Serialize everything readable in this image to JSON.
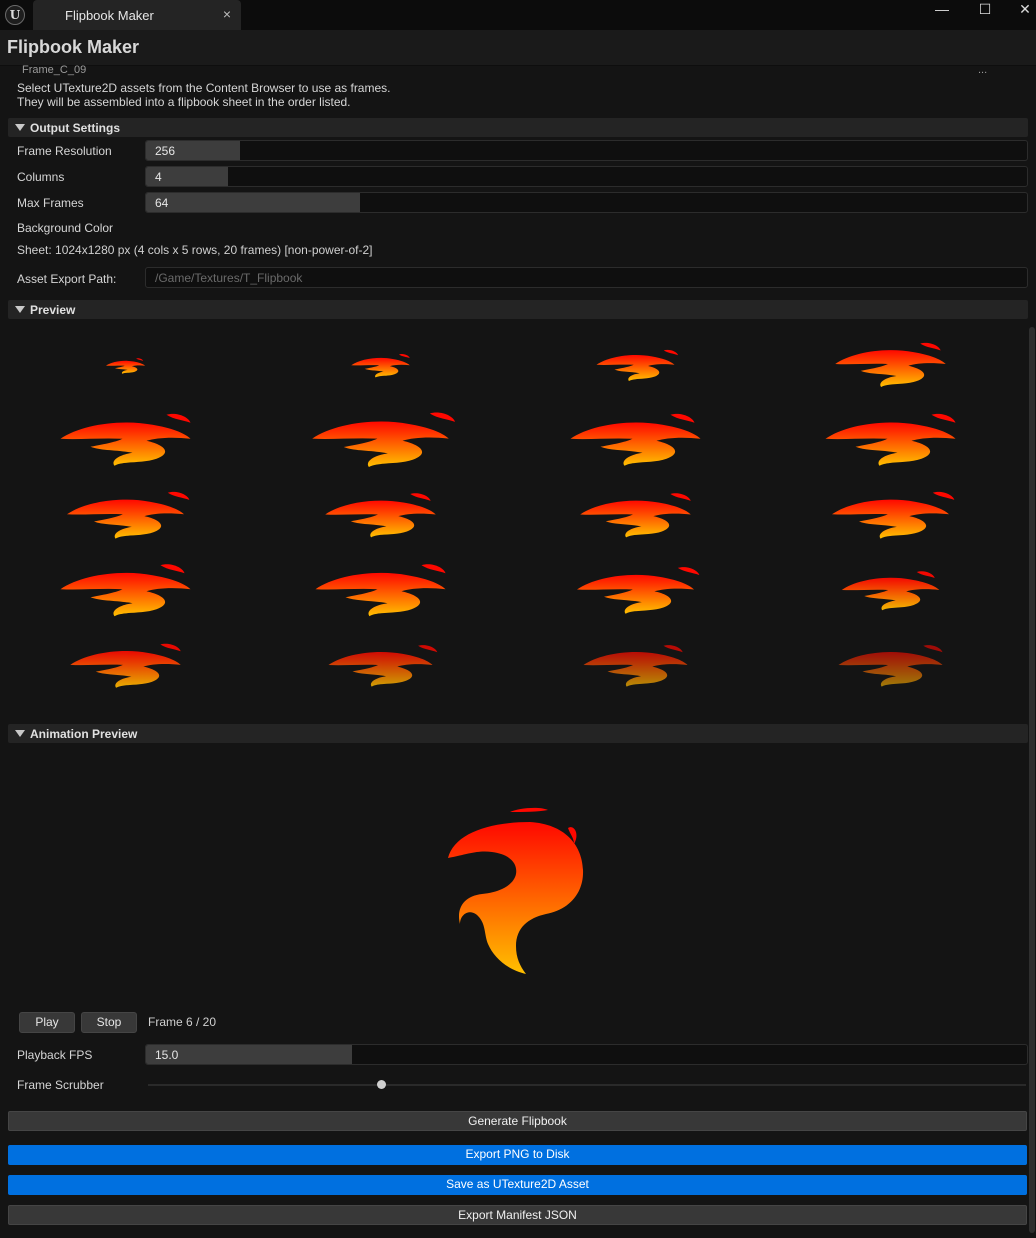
{
  "window": {
    "tab_title": "Flipbook Maker",
    "close_glyph": "×",
    "minimize_glyph": "—",
    "maximize_glyph": "☐",
    "win_close_glyph": "✕",
    "logo_glyph": "U",
    "logo_icon": "unreal-engine-logo"
  },
  "header": {
    "title": "Flipbook Maker"
  },
  "frames_list": {
    "partial_item": "Frame_C_09",
    "partial_suffix": "..."
  },
  "help_text": {
    "line1": "Select UTexture2D assets from the Content Browser to use as frames.",
    "line2": "They will be assembled into a flipbook sheet in the order listed."
  },
  "output_settings": {
    "header": "Output Settings",
    "frame_resolution": {
      "label": "Frame Resolution",
      "value": "256",
      "fill": 0.107
    },
    "columns": {
      "label": "Columns",
      "value": "4",
      "fill": 0.093
    },
    "max_frames": {
      "label": "Max Frames",
      "value": "64",
      "fill": 0.243
    },
    "background_color_label": "Background Color",
    "sheet_info": "Sheet: 1024x1280 px (4 cols x 5 rows, 20 frames) [non-power-of-2]",
    "export_path": {
      "label": "Asset Export Path:",
      "placeholder": "/Game/Textures/T_Flipbook"
    }
  },
  "preview": {
    "header": "Preview",
    "columns": 4,
    "rows": 5,
    "frame_count": 20,
    "colors": {
      "top": "#ff0800",
      "bottom": "#ffc000"
    }
  },
  "animation_preview": {
    "header": "Animation Preview",
    "play_label": "Play",
    "stop_label": "Stop",
    "frame_readout": "Frame 6 / 20",
    "current_frame": 6,
    "total_frames": 20,
    "playback_fps": {
      "label": "Playback FPS",
      "value": "15.0",
      "fill": 0.234
    },
    "scrubber_label": "Frame Scrubber",
    "scrubber_fraction": 0.265
  },
  "actions": {
    "generate": "Generate Flipbook",
    "export_png": "Export PNG to Disk",
    "save_asset": "Save as UTexture2D Asset",
    "export_manifest": "Export Manifest JSON"
  },
  "colors": {
    "accent_blue": "#0070e0",
    "panel_bg": "#141414",
    "flame_red": "#ff0800",
    "flame_yellow": "#ffc000"
  }
}
